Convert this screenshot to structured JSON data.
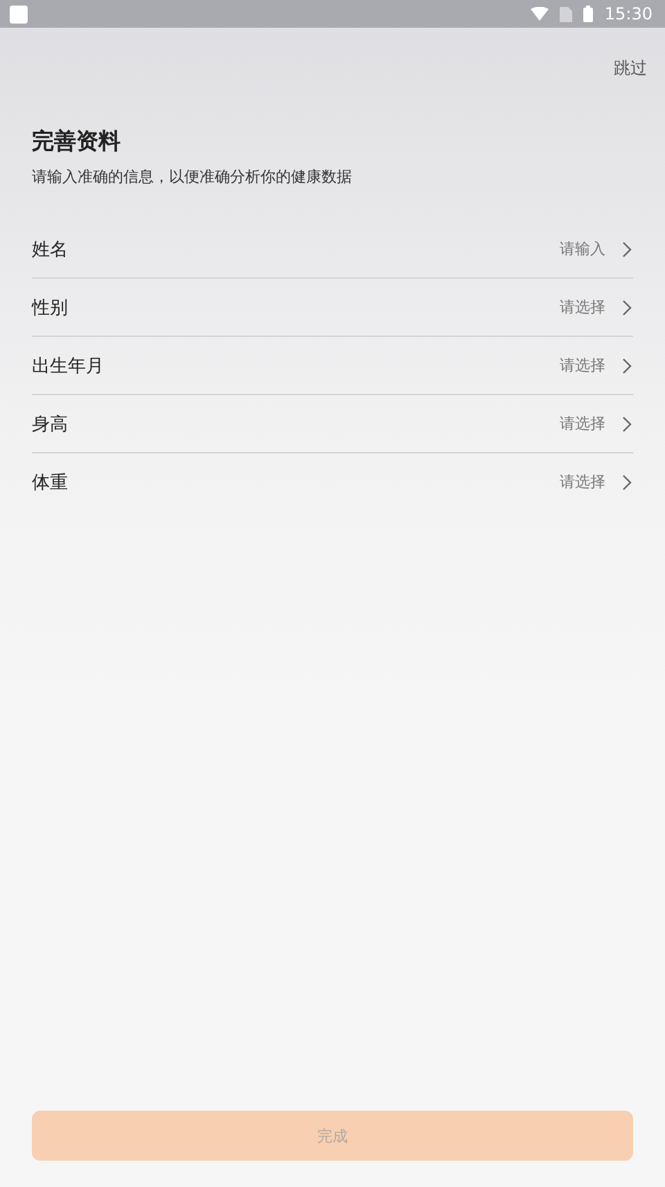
{
  "status_bar": {
    "time": "15:30"
  },
  "skip": "跳过",
  "title": "完善资料",
  "subtitle": "请输入准确的信息，以便准确分析你的健康数据",
  "fields": [
    {
      "label": "姓名",
      "placeholder": "请输入"
    },
    {
      "label": "性别",
      "placeholder": "请选择"
    },
    {
      "label": "出生年月",
      "placeholder": "请选择"
    },
    {
      "label": "身高",
      "placeholder": "请选择"
    },
    {
      "label": "体重",
      "placeholder": "请选择"
    }
  ],
  "finish_button": {
    "label": "完成",
    "disabled": true
  }
}
